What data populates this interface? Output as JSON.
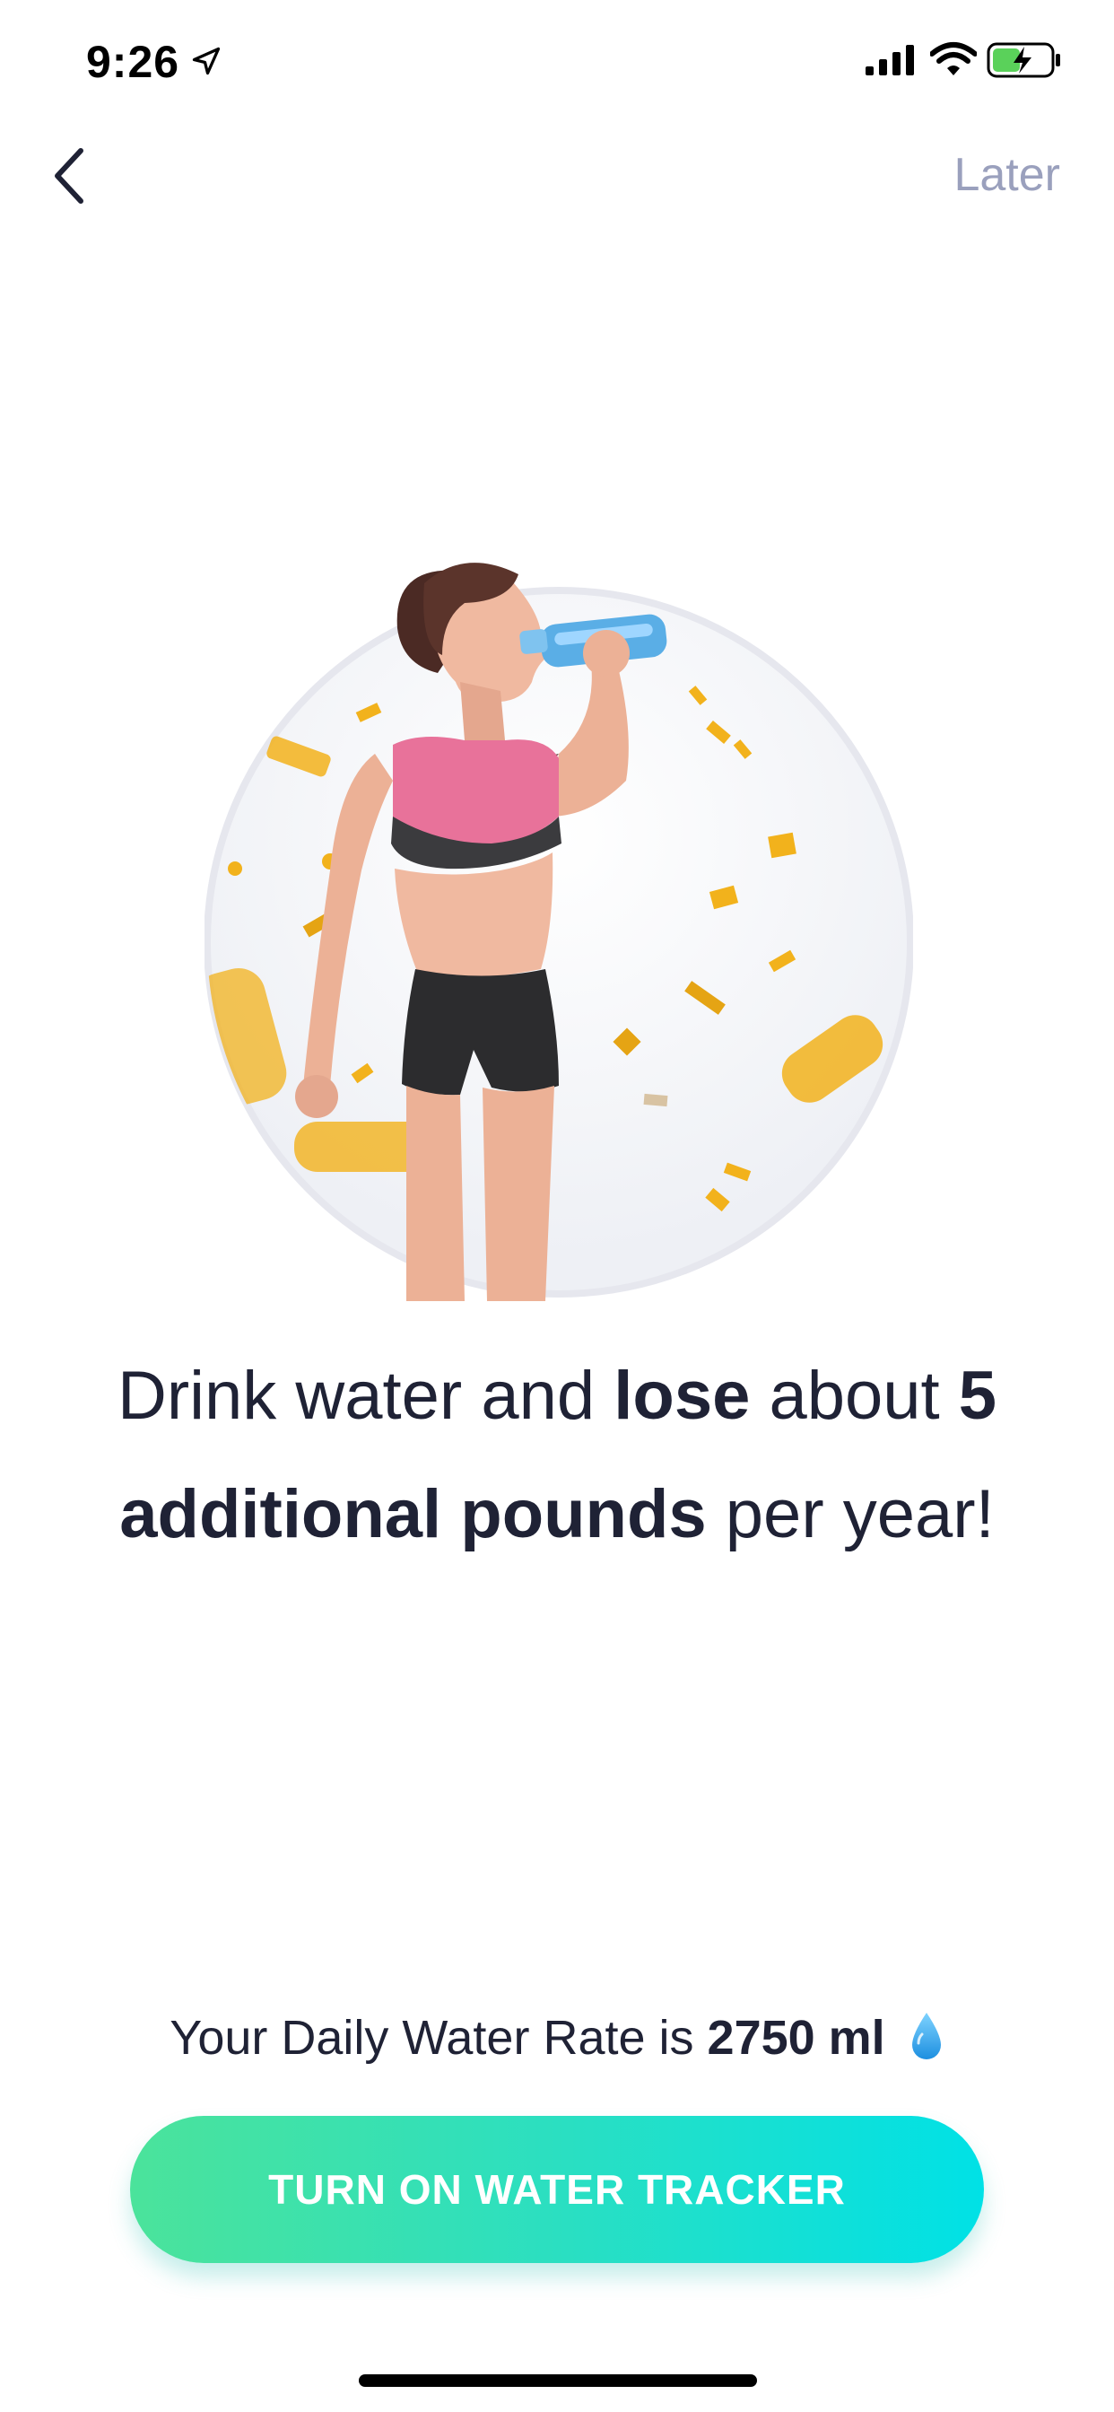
{
  "status_bar": {
    "time": "9:26",
    "icons": [
      "location-arrow-icon",
      "signal-icon",
      "wifi-icon",
      "battery-charging-icon"
    ]
  },
  "nav": {
    "back_icon": "chevron-left-icon",
    "later_label": "Later"
  },
  "hero": {
    "icon": "woman-drinking-water-illustration",
    "accent_confetti": "#f2b21c",
    "ring_color": "#e6e7ee"
  },
  "headline": {
    "part1": "Drink water and ",
    "bold1": "lose",
    "part2": " about ",
    "bold2": "5 additional pounds",
    "part3": " per year!"
  },
  "rate": {
    "prefix": "Your Daily Water Rate is ",
    "value": "2750 ml",
    "icon": "water-drop-icon"
  },
  "cta": {
    "label": "TURN ON WATER TRACKER",
    "gradient_start": "#4be39b",
    "gradient_end": "#00e1e6"
  }
}
